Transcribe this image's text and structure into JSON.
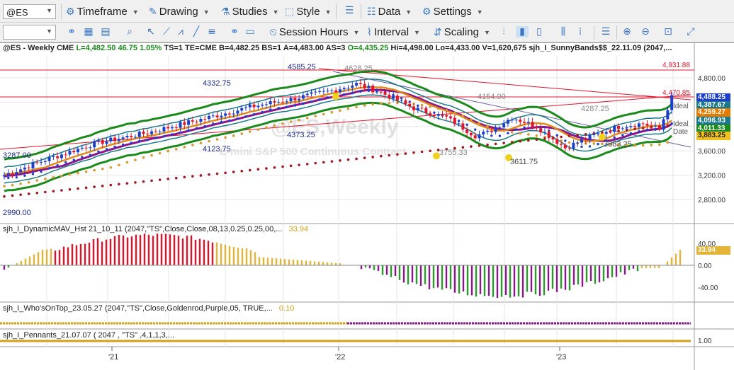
{
  "toolbar1": {
    "symbol": "@ES",
    "menus": [
      "Timeframe",
      "Drawing",
      "Studies",
      "Style",
      "Data",
      "Settings"
    ]
  },
  "toolbar2": {
    "menus": [
      "Session Hours",
      "Interval",
      "Scaling"
    ]
  },
  "header": {
    "title": "@ES - Weekly  CME",
    "l": "L=4,482.50",
    "chg": "46.75",
    "pct": "1.05%",
    "ts": "TS=1",
    "te": "TE=CME",
    "b": "B=4,482.25",
    "bs": "BS=1",
    "a": "A=4,483.00",
    "as": "AS=3",
    "o": "O=4,435.25",
    "hi": "Hi=4,498.00",
    "lo": "Lo=4,433.00",
    "v": "V=1,620,675",
    "study": "sjh_I_SunnyBands$$_22.11.09 (2047,..."
  },
  "watermark": {
    "symbol": "@ES,Weekly",
    "name": "E-mini S&P 500 Continuous Contract"
  },
  "price_labels": {
    "l4585": "4585.25",
    "l4332": "4332.75",
    "l4373": "4373.25",
    "l4123": "4123.75",
    "l3287": "3287.00",
    "l2990": "2990.00",
    "l3611": "3611.75",
    "l4154": "4154.00",
    "l4287": "4287.25",
    "l3883": "3883.25",
    "l4628": "4628.25",
    "l3755": "3755.33"
  },
  "right_labels": {
    "ideal1": "Ideal",
    "ideal2": "Ideal",
    "date": "Date",
    "r4931": "4,931.88",
    "r4470": "4,470.85"
  },
  "axis": {
    "main": [
      "4,800.00",
      "4,400.00",
      "4,000.00",
      "3,600.00",
      "3,200.00",
      "2,800.00"
    ],
    "ind1": [
      "40.00",
      "0.00",
      "-40.00"
    ],
    "ind3": [
      "1.00"
    ],
    "x": [
      "'21",
      "'22",
      "'23"
    ]
  },
  "tags": {
    "t1": "4,488.25",
    "t2": "4,387.67",
    "t3": "4,259.27",
    "t4": "4,096.93",
    "t5": "4,011.33",
    "t6": "3,883.25",
    "hist": "33.94"
  },
  "colors": {
    "bull": "#1e3fc8",
    "bear": "#e0142b",
    "band": "#1a8a1a",
    "gold": "#d4a017",
    "purple": "#8a148a",
    "teal": "#1a7a8a",
    "red_dot": "#a01820",
    "hist_gold": "#e3b438",
    "hist_red": "#e01428",
    "hist_purple": "#8a148a",
    "hist_green": "#2a9a2a"
  },
  "panes": {
    "p1": {
      "name": "sjh_I_DynamicMAV_Hst 21_10_11 (2047,\"TS\",Close,Close,08,13,0.25,0.25,00,...",
      "val": "33.94"
    },
    "p2": {
      "name": "sjh_I_Who'sOnTop_23.05.27 (2047,\"TS\",Close,Goldenrod,Purple,05,  TRUE,...",
      "val": "0.10"
    },
    "p3": {
      "name": "sjh_I_Pennants_21.07.07 ( 2047 , \"TS\" ,4,1,1,3,..."
    }
  }
}
